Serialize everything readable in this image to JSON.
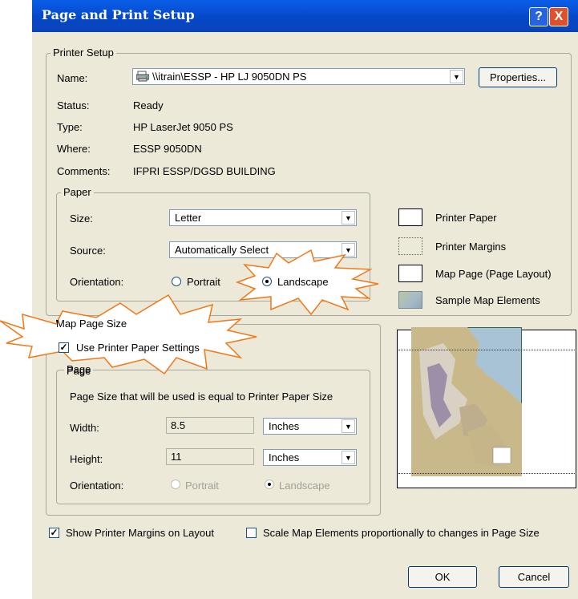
{
  "window": {
    "title": "Page and Print Setup",
    "help": "?",
    "close": "X"
  },
  "printer_setup": {
    "legend": "Printer Setup",
    "name_label": "Name:",
    "name_value": "\\\\itrain\\ESSP - HP LJ 9050DN PS",
    "properties_button": "Properties...",
    "status_label": "Status:",
    "status_value": "Ready",
    "type_label": "Type:",
    "type_value": "HP LaserJet 9050 PS",
    "where_label": "Where:",
    "where_value": "ESSP 9050DN",
    "comments_label": "Comments:",
    "comments_value": "IFPRI ESSP/DGSD BUILDING"
  },
  "paper": {
    "legend": "Paper",
    "size_label": "Size:",
    "size_value": "Letter",
    "source_label": "Source:",
    "source_value": "Automatically Select",
    "orientation_label": "Orientation:",
    "portrait": "Portrait",
    "landscape": "Landscape",
    "selected": "Landscape"
  },
  "preview_legend": {
    "printer_paper": "Printer Paper",
    "printer_margins": "Printer Margins",
    "map_page": "Map Page (Page Layout)",
    "sample_map": "Sample Map Elements"
  },
  "map_page_size": {
    "legend": "Map Page Size",
    "use_printer_paper": "Use Printer Paper Settings",
    "use_printer_paper_checked": true,
    "page_legend": "Page",
    "info_text": "Page Size that will be used is equal to Printer Paper Size",
    "width_label": "Width:",
    "width_value": "8.5",
    "width_units": "Inches",
    "height_label": "Height:",
    "height_value": "11",
    "height_units": "Inches",
    "orientation_label": "Orientation:",
    "portrait": "Portrait",
    "landscape": "Landscape"
  },
  "options": {
    "show_margins": "Show Printer Margins on Layout",
    "show_margins_checked": true,
    "scale_elements": "Scale Map Elements proportionally to changes in Page Size",
    "scale_elements_checked": false
  },
  "buttons": {
    "ok": "OK",
    "cancel": "Cancel"
  },
  "colors": {
    "title_bar": "#0548c9",
    "dialog_bg": "#ece9d8",
    "callout_stroke": "#f07818"
  }
}
